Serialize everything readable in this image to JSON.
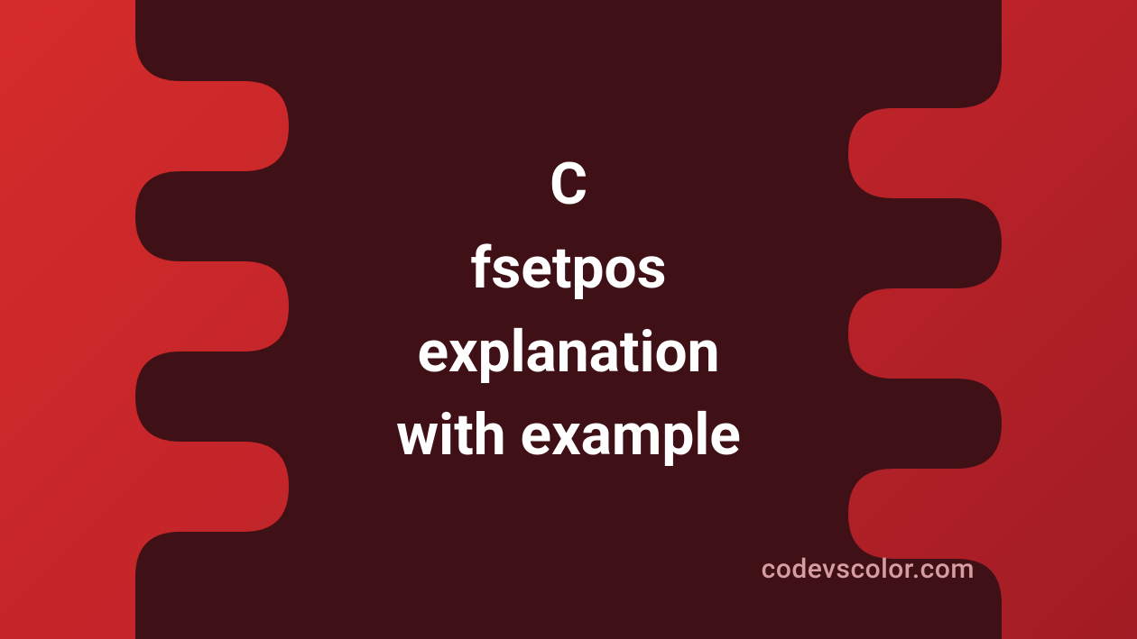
{
  "banner": {
    "title_line_1": "C",
    "title_line_2": "fsetpos",
    "title_line_3": "explanation",
    "title_line_4": "with example",
    "watermark": "codevscolor.com"
  },
  "colors": {
    "background_gradient_start": "#d52b2b",
    "background_gradient_end": "#a11c24",
    "blob_fill": "#3f1117",
    "title_text": "#ffffff",
    "watermark_text": "#d69ea0"
  }
}
